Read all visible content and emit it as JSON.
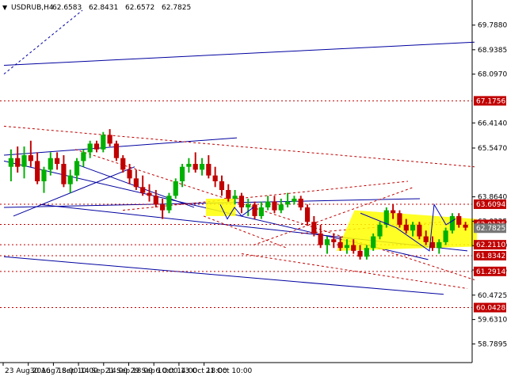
{
  "chart_data": {
    "type": "candlestick",
    "header": {
      "symbol": "USDRUB,H4",
      "open": "62.6583",
      "high": "62.8431",
      "low": "62.6572",
      "close": "62.7825"
    },
    "y_axis": {
      "range": [
        58.2,
        70.6
      ],
      "ticks": [
        "69.7880",
        "68.9385",
        "68.0970",
        "66.4140",
        "65.5470",
        "63.8640",
        "63.0225",
        "62.1810",
        "61.3395",
        "60.4725",
        "59.6310",
        "58.7895"
      ],
      "tick_values": [
        69.788,
        68.9385,
        68.097,
        66.414,
        65.547,
        63.864,
        63.0225,
        62.181,
        61.3395,
        60.4725,
        59.631,
        58.7895
      ]
    },
    "x_axis": {
      "ticks": [
        "23 Aug 2016",
        "30 Aug 18:00",
        "7 Sep 10:00",
        "14 Sep 14:00",
        "21 Sep 18:00",
        "29 Sep 10:00",
        "6 Oct 14:00",
        "13 Oct 18:00",
        "21 Oct 10:00"
      ],
      "tick_index": [
        0,
        38,
        76,
        114,
        152,
        190,
        228,
        266,
        304
      ]
    },
    "price_levels": [
      {
        "label": "67.1756",
        "value": 67.1756
      },
      {
        "label": "63.6094",
        "value": 63.6094
      },
      {
        "label": "62.9125",
        "value": 62.9125
      },
      {
        "label": "62.2110",
        "value": 62.211
      },
      {
        "label": "61.8342",
        "value": 61.8342
      },
      {
        "label": "61.2914",
        "value": 61.2914
      },
      {
        "label": "60.0428",
        "value": 60.0428
      }
    ],
    "current_price": {
      "label": "62.7825",
      "value": 62.7825
    },
    "colors": {
      "bull": "#00b000",
      "bear": "#c00000",
      "level_line": "#c00000",
      "level_box": "#c00000",
      "trend_line": "#0000a0",
      "forecast_line": "#0000c0",
      "zone_fill": "#ffff00",
      "current_box": "#777777",
      "axis": "#000000"
    },
    "candles": [
      [
        64.9,
        65.5,
        64.4,
        65.2
      ],
      [
        65.2,
        65.6,
        64.7,
        64.9
      ],
      [
        64.9,
        65.6,
        64.5,
        65.3
      ],
      [
        65.3,
        65.8,
        64.9,
        65.1
      ],
      [
        65.1,
        65.4,
        64.3,
        64.4
      ],
      [
        64.4,
        64.9,
        64.0,
        64.8
      ],
      [
        64.8,
        65.4,
        64.6,
        65.2
      ],
      [
        65.2,
        65.4,
        64.8,
        65.0
      ],
      [
        65.0,
        65.3,
        64.2,
        64.3
      ],
      [
        64.3,
        64.8,
        64.0,
        64.6
      ],
      [
        64.6,
        65.2,
        64.4,
        65.1
      ],
      [
        65.1,
        65.5,
        64.9,
        65.4
      ],
      [
        65.4,
        65.8,
        65.2,
        65.7
      ],
      [
        65.7,
        65.8,
        65.4,
        65.5
      ],
      [
        65.5,
        66.1,
        65.4,
        66.0
      ],
      [
        66.0,
        66.2,
        65.6,
        65.7
      ],
      [
        65.7,
        65.8,
        65.1,
        65.2
      ],
      [
        65.2,
        65.3,
        64.7,
        64.8
      ],
      [
        64.8,
        65.0,
        64.3,
        64.5
      ],
      [
        64.5,
        64.8,
        64.1,
        64.2
      ],
      [
        64.2,
        64.6,
        63.9,
        64.0
      ],
      [
        64.0,
        64.3,
        63.7,
        63.9
      ],
      [
        63.9,
        64.1,
        63.5,
        63.6
      ],
      [
        63.6,
        63.8,
        63.1,
        63.4
      ],
      [
        63.4,
        64.0,
        63.3,
        63.9
      ],
      [
        63.9,
        64.5,
        63.8,
        64.4
      ],
      [
        64.4,
        65.0,
        64.2,
        64.9
      ],
      [
        64.9,
        65.2,
        64.7,
        65.0
      ],
      [
        65.0,
        65.4,
        64.7,
        64.8
      ],
      [
        64.8,
        65.2,
        64.6,
        65.0
      ],
      [
        65.0,
        65.3,
        64.5,
        64.6
      ],
      [
        64.6,
        64.9,
        64.2,
        64.4
      ],
      [
        64.4,
        64.6,
        63.9,
        64.1
      ],
      [
        64.1,
        64.3,
        63.7,
        63.8
      ],
      [
        63.8,
        64.1,
        63.6,
        63.9
      ],
      [
        63.9,
        64.0,
        63.3,
        63.5
      ],
      [
        63.5,
        63.8,
        63.2,
        63.6
      ],
      [
        63.6,
        63.7,
        63.1,
        63.2
      ],
      [
        63.2,
        63.7,
        63.1,
        63.5
      ],
      [
        63.5,
        63.9,
        63.4,
        63.7
      ],
      [
        63.7,
        63.9,
        63.3,
        63.4
      ],
      [
        63.4,
        63.8,
        63.3,
        63.6
      ],
      [
        63.6,
        64.0,
        63.5,
        63.7
      ],
      [
        63.7,
        63.9,
        63.6,
        63.8
      ],
      [
        63.8,
        63.9,
        63.4,
        63.5
      ],
      [
        63.5,
        63.6,
        62.9,
        63.0
      ],
      [
        63.0,
        63.2,
        62.5,
        62.6
      ],
      [
        62.6,
        62.9,
        62.1,
        62.2
      ],
      [
        62.2,
        62.5,
        61.9,
        62.4
      ],
      [
        62.4,
        62.6,
        62.1,
        62.3
      ],
      [
        62.3,
        62.5,
        62.0,
        62.1
      ],
      [
        62.1,
        62.4,
        61.9,
        62.2
      ],
      [
        62.2,
        62.4,
        61.9,
        62.0
      ],
      [
        62.0,
        62.2,
        61.7,
        61.8
      ],
      [
        61.8,
        62.2,
        61.7,
        62.1
      ],
      [
        62.1,
        62.6,
        62.0,
        62.5
      ],
      [
        62.5,
        63.0,
        62.4,
        62.9
      ],
      [
        62.9,
        63.5,
        62.8,
        63.4
      ],
      [
        63.4,
        63.6,
        63.1,
        63.3
      ],
      [
        63.3,
        63.4,
        62.8,
        62.9
      ],
      [
        62.9,
        63.1,
        62.6,
        62.7
      ],
      [
        62.7,
        63.0,
        62.5,
        62.9
      ],
      [
        62.9,
        63.0,
        62.4,
        62.5
      ],
      [
        62.5,
        62.7,
        62.2,
        62.3
      ],
      [
        62.3,
        62.5,
        62.0,
        62.1
      ],
      [
        62.1,
        62.4,
        61.9,
        62.3
      ],
      [
        62.3,
        62.8,
        62.2,
        62.7
      ],
      [
        62.7,
        63.3,
        62.6,
        63.2
      ],
      [
        63.2,
        63.3,
        62.8,
        62.9
      ],
      [
        62.9,
        63.0,
        62.7,
        62.8
      ]
    ]
  }
}
